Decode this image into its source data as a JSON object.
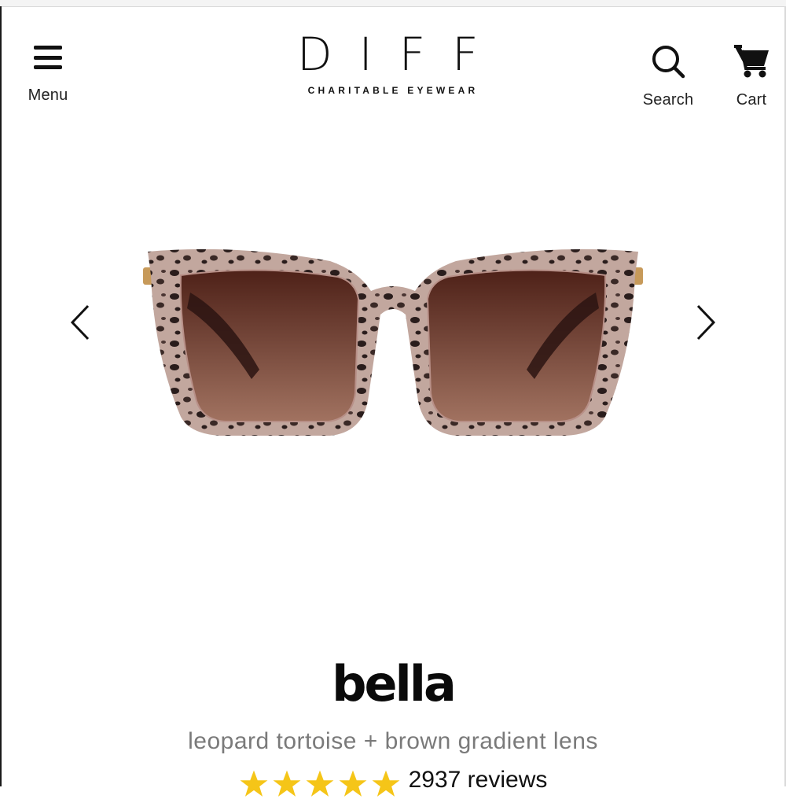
{
  "header": {
    "menu_label": "Menu",
    "logo_main": "DIFF",
    "logo_sub": "CHARITABLE EYEWEAR",
    "search_label": "Search",
    "cart_label": "Cart"
  },
  "gallery": {
    "prev_icon": "chevron-left-icon",
    "next_icon": "chevron-right-icon",
    "image_subject": "sunglasses"
  },
  "product": {
    "name": "bella",
    "variant": "leopard tortoise + brown gradient lens",
    "rating_stars": 5,
    "reviews": "2937 reviews"
  },
  "colors": {
    "text": "#111111",
    "variant_text": "#7a7a7a",
    "star": "#f5c518",
    "frame": "#b89a90",
    "lens_top": "#5a2a1e",
    "lens_bottom": "#9a6a58"
  }
}
